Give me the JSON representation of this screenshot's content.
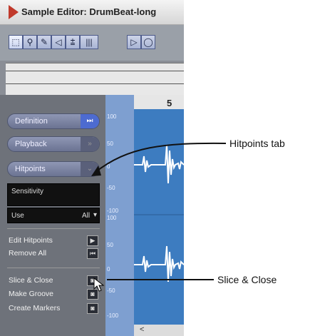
{
  "window": {
    "title": "Sample Editor: DrumBeat-long"
  },
  "toolbar": {
    "tools": [
      {
        "name": "range-select",
        "glyph": "⬚",
        "selected": true
      },
      {
        "name": "zoom",
        "glyph": "⚲"
      },
      {
        "name": "draw",
        "glyph": "✎"
      },
      {
        "name": "play",
        "glyph": "◁"
      },
      {
        "name": "scrub",
        "glyph": "⩲"
      },
      {
        "name": "grid",
        "glyph": "|||"
      },
      {
        "name": "play-triangle",
        "glyph": "▷"
      },
      {
        "name": "loop",
        "glyph": "◯"
      }
    ]
  },
  "panel": {
    "definition_label": "Definition",
    "playback_label": "Playback",
    "hitpoints_label": "Hitpoints",
    "sensitivity_label": "Sensitivity",
    "use_label": "Use",
    "use_value": "All",
    "edit_hitpoints_label": "Edit Hitpoints",
    "remove_all_label": "Remove All",
    "slice_close_label": "Slice & Close",
    "make_groove_label": "Make Groove",
    "create_markers_label": "Create Markers"
  },
  "ruler": {
    "ticks": [
      "100",
      "50",
      "0",
      "-50",
      "-100",
      "100",
      "50",
      "0",
      "-50",
      "-100"
    ]
  },
  "timeline": {
    "bar_number": "5"
  },
  "callouts": {
    "hitpoints_tab": "Hitpoints tab",
    "slice_close": "Slice & Close"
  }
}
